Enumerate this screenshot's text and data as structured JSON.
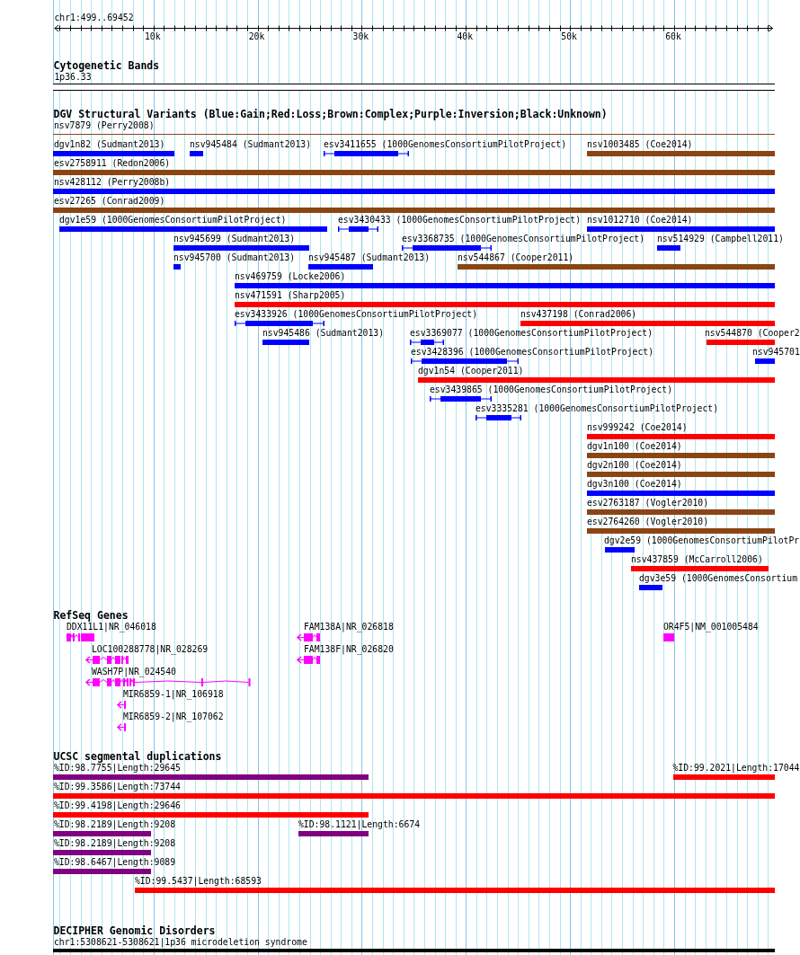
{
  "ruler": {
    "location": "chr1:499..69452",
    "tick_labels": [
      "10k",
      "20k",
      "30k",
      "40k",
      "50k",
      "60k"
    ]
  },
  "tracks": [
    {
      "kind": "cytoband",
      "title": "Cytogenetic Bands",
      "features": [
        {
          "label": "1p36.33"
        }
      ]
    },
    {
      "kind": "variants",
      "title": "DGV Structural Variants (Blue:Gain;Red:Loss;Brown:Complex;Purple:Inversion;Black:Unknown)",
      "rows": [
        [
          {
            "label": "nsv7879 (Perry2008)",
            "color": "#8b4513",
            "kind": "line"
          }
        ],
        [
          {
            "label": "dgv1n82 (Sudmant2013)",
            "color": "#0000ff",
            "kind": "solid"
          },
          {
            "label": "nsv945484 (Sudmant2013)",
            "color": "#0000ff",
            "kind": "solid"
          },
          {
            "label": "esv3411655 (1000GenomesConsortiumPilotProject)",
            "color": "#0000ff",
            "kind": "bracketed"
          },
          {
            "label": "nsv1003485 (Coe2014)",
            "color": "#8b4513",
            "kind": "solid"
          }
        ],
        [
          {
            "label": "esv2758911 (Redon2006)",
            "color": "#8b4513",
            "kind": "solid"
          }
        ],
        [
          {
            "label": "nsv428112 (Perry2008b)",
            "color": "#0000ff",
            "kind": "solid"
          }
        ],
        [
          {
            "label": "esv27265 (Conrad2009)",
            "color": "#8b4513",
            "kind": "solid"
          }
        ],
        [
          {
            "label": "dgv1e59 (1000GenomesConsortiumPilotProject)",
            "color": "#0000ff",
            "kind": "solid"
          },
          {
            "label": "esv3430433 (1000GenomesConsortiumPilotProject)",
            "color": "#0000ff",
            "kind": "bracketed"
          },
          {
            "label": "nsv1012710 (Coe2014)",
            "color": "#0000ff",
            "kind": "solid"
          }
        ],
        [
          {
            "label": "nsv945699 (Sudmant2013)",
            "color": "#0000ff",
            "kind": "solid"
          },
          {
            "label": "esv3368735 (1000GenomesConsortiumPilotProject)",
            "color": "#0000ff",
            "kind": "bracketed"
          },
          {
            "label": "nsv514929 (Campbell2011)",
            "color": "#0000ff",
            "kind": "solid"
          }
        ],
        [
          {
            "label": "nsv945700 (Sudmant2013)",
            "color": "#0000ff",
            "kind": "solid"
          },
          {
            "label": "nsv945487 (Sudmant2013)",
            "color": "#0000ff",
            "kind": "solid"
          },
          {
            "label": "nsv544867 (Cooper2011)",
            "color": "#8b4513",
            "kind": "solid"
          }
        ],
        [
          {
            "label": "nsv469759 (Locke2006)",
            "color": "#0000ff",
            "kind": "solid"
          }
        ],
        [
          {
            "label": "nsv471591 (Sharp2005)",
            "color": "#ff0000",
            "kind": "solid"
          }
        ],
        [
          {
            "label": "esv3433926 (1000GenomesConsortiumPilotProject)",
            "color": "#0000ff",
            "kind": "bracketed"
          },
          {
            "label": "nsv437198 (Conrad2006)",
            "color": "#ff0000",
            "kind": "solid"
          }
        ],
        [
          {
            "label": "nsv945486 (Sudmant2013)",
            "color": "#0000ff",
            "kind": "solid"
          },
          {
            "label": "esv3369077 (1000GenomesConsortiumPilotProject)",
            "color": "#0000ff",
            "kind": "bracketed"
          },
          {
            "label": "nsv544870 (Cooper2",
            "color": "#ff0000",
            "kind": "solid"
          }
        ],
        [
          {
            "label": "esv3428396 (1000GenomesConsortiumPilotProject)",
            "color": "#0000ff",
            "kind": "bracketed"
          },
          {
            "label": "nsv945701",
            "color": "#0000ff",
            "kind": "solid"
          }
        ],
        [
          {
            "label": "dgv1n54 (Cooper2011)",
            "color": "#ff0000",
            "kind": "solid"
          }
        ],
        [
          {
            "label": "esv3439865 (1000GenomesConsortiumPilotProject)",
            "color": "#0000ff",
            "kind": "bracketed"
          }
        ],
        [
          {
            "label": "esv3335281 (1000GenomesConsortiumPilotProject)",
            "color": "#0000ff",
            "kind": "bracketed"
          }
        ],
        [
          {
            "label": "nsv999242 (Coe2014)",
            "color": "#ff0000",
            "kind": "solid"
          }
        ],
        [
          {
            "label": "dgv1n100 (Coe2014)",
            "color": "#8b4513",
            "kind": "solid"
          }
        ],
        [
          {
            "label": "dgv2n100 (Coe2014)",
            "color": "#8b4513",
            "kind": "solid"
          }
        ],
        [
          {
            "label": "dgv3n100 (Coe2014)",
            "color": "#0000ff",
            "kind": "solid"
          }
        ],
        [
          {
            "label": "esv2763187 (Vogler2010)",
            "color": "#8b4513",
            "kind": "solid"
          }
        ],
        [
          {
            "label": "esv2764260 (Vogler2010)",
            "color": "#8b4513",
            "kind": "solid"
          }
        ],
        [
          {
            "label": "dgv2e59 (1000GenomesConsortiumPilotPr",
            "color": "#0000ff",
            "kind": "solid"
          }
        ],
        [
          {
            "label": "nsv437859 (McCarroll2006)",
            "color": "#ff0000",
            "kind": "solid"
          }
        ],
        [
          {
            "label": "dgv3e59 (1000GenomesConsortium",
            "color": "#0000ff",
            "kind": "solid"
          }
        ]
      ]
    },
    {
      "kind": "genes",
      "title": "RefSeq Genes",
      "rows": [
        [
          {
            "label": "DDX11L1|NR_046018",
            "minus_strand": false
          },
          {
            "label": "FAM138A|NR_026818",
            "minus_strand": true
          },
          {
            "label": "OR4F5|NM_001005484",
            "minus_strand": false
          }
        ],
        [
          {
            "label": "LOC100288778|NR_028269",
            "minus_strand": true
          },
          {
            "label": "FAM138F|NR_026820",
            "minus_strand": true
          }
        ],
        [
          {
            "label": "WASH7P|NR_024540",
            "minus_strand": true
          }
        ],
        [
          {
            "label": "MIR6859-1|NR_106918",
            "minus_strand": true
          }
        ],
        [
          {
            "label": "MIR6859-2|NR_107062",
            "minus_strand": true
          }
        ]
      ]
    },
    {
      "kind": "variants",
      "title": "UCSC segmental duplications",
      "rows": [
        [
          {
            "label": "%ID:98.7755|Length:29645",
            "color": "#800080",
            "kind": "solid"
          },
          {
            "label": "%ID:99.2021|Length:17044",
            "color": "#ff0000",
            "kind": "solid"
          }
        ],
        [
          {
            "label": "%ID:99.3586|Length:73744",
            "color": "#ff0000",
            "kind": "solid"
          }
        ],
        [
          {
            "label": "%ID:99.4198|Length:29646",
            "color": "#ff0000",
            "kind": "solid"
          }
        ],
        [
          {
            "label": "%ID:98.2189|Length:9208",
            "color": "#800080",
            "kind": "solid"
          },
          {
            "label": "%ID:98.1121|Length:6674",
            "color": "#800080",
            "kind": "solid"
          }
        ],
        [
          {
            "label": "%ID:98.2189|Length:9208",
            "color": "#800080",
            "kind": "solid"
          }
        ],
        [
          {
            "label": "%ID:98.6467|Length:9089",
            "color": "#800080",
            "kind": "solid"
          }
        ],
        [
          {
            "label": "%ID:99.5437|Length:68593",
            "color": "#ff0000",
            "kind": "solid"
          }
        ]
      ]
    },
    {
      "kind": "variants",
      "title": "DECIPHER Genomic Disorders",
      "rows": [
        [
          {
            "label": "chr1:5308621-5308621|1p36 microdeletion syndrome",
            "color": "#000000",
            "kind": "solid"
          }
        ]
      ]
    }
  ]
}
